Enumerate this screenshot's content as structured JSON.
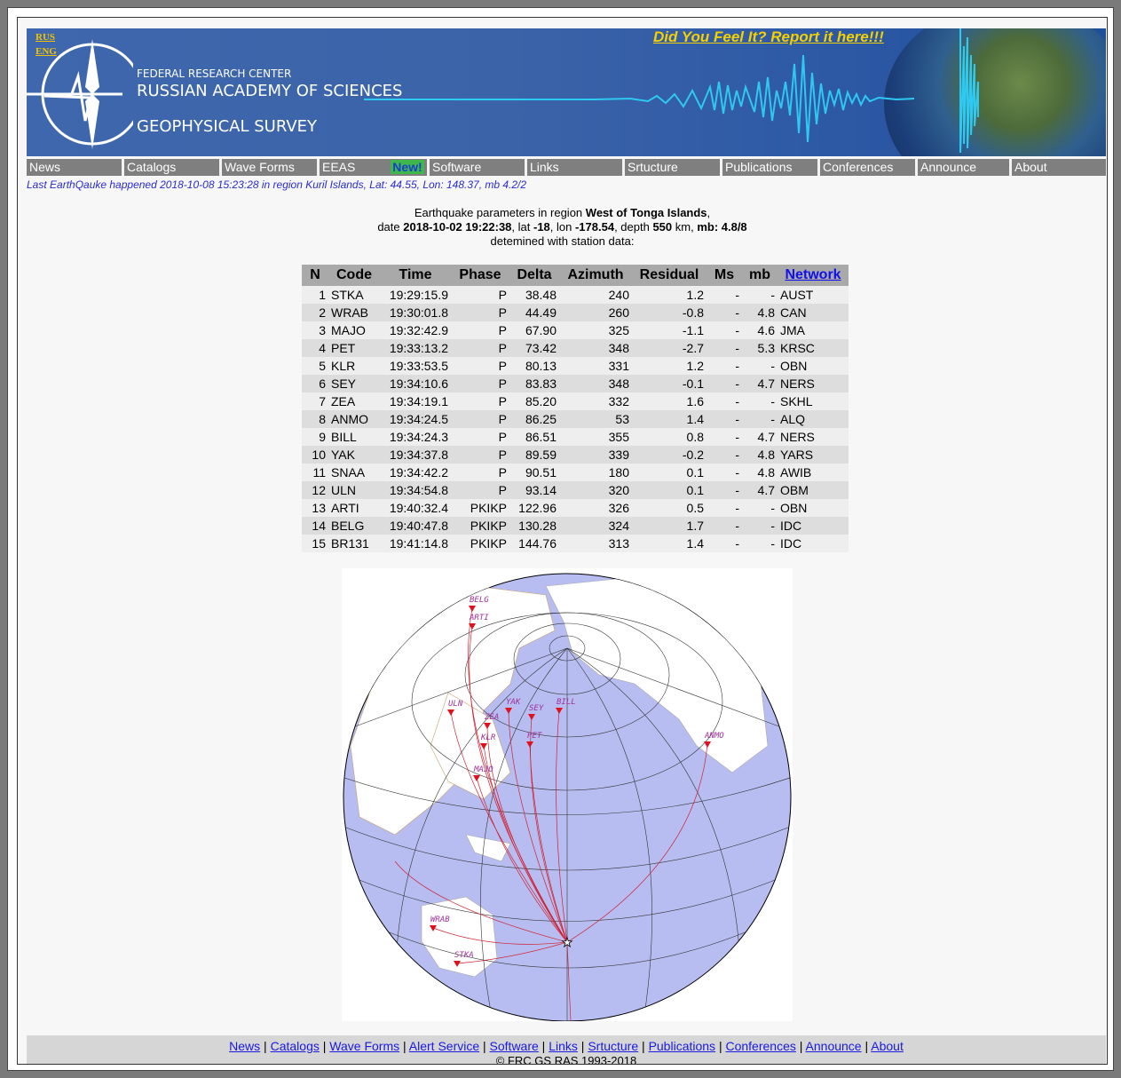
{
  "banner": {
    "lang_rus": "RUS",
    "lang_eng": "ENG",
    "line1": "FEDERAL RESEARCH CENTER",
    "line2": "RUSSIAN ACADEMY OF SCIENCES",
    "line3": "GEOPHYSICAL SURVEY",
    "feel_link": "Did You Feel It? Report it here!!!"
  },
  "nav": {
    "items": [
      "News",
      "Catalogs",
      "Wave Forms",
      "EEAS",
      "New!",
      "Software",
      "Links",
      "Srtucture",
      "Publications",
      "Conferences",
      "Announce",
      "About"
    ]
  },
  "last_quake": "Last EarthQauke happened 2018-10-08 15:23:28 in region Kuril Islands, Lat: 44.55, Lon: 148.37, mb 4.2/2",
  "params": {
    "intro": "Earthquake parameters in region ",
    "region": "West of Tonga Islands",
    "date_label": "date ",
    "date": "2018-10-02 19:22:38",
    "lat_label": ", lat ",
    "lat": "-18",
    "lon_label": ", lon ",
    "lon": "-178.54",
    "depth_label": ", depth ",
    "depth": "550",
    "km_label": " km, ",
    "mb_label": "mb: 4.8/8",
    "line3": "detemined with station data:"
  },
  "table": {
    "headers": [
      "N",
      "Code",
      "Time",
      "Phase",
      "Delta",
      "Azimuth",
      "Residual",
      "Ms",
      "mb",
      "Network"
    ],
    "rows": [
      [
        "1",
        "STKA",
        "19:29:15.9",
        "P",
        "38.48",
        "240",
        "1.2",
        "-",
        "-",
        "AUST"
      ],
      [
        "2",
        "WRAB",
        "19:30:01.8",
        "P",
        "44.49",
        "260",
        "-0.8",
        "-",
        "4.8",
        "CAN"
      ],
      [
        "3",
        "MAJO",
        "19:32:42.9",
        "P",
        "67.90",
        "325",
        "-1.1",
        "-",
        "4.6",
        "JMA"
      ],
      [
        "4",
        "PET",
        "19:33:13.2",
        "P",
        "73.42",
        "348",
        "-2.7",
        "-",
        "5.3",
        "KRSC"
      ],
      [
        "5",
        "KLR",
        "19:33:53.5",
        "P",
        "80.13",
        "331",
        "1.2",
        "-",
        "-",
        "OBN"
      ],
      [
        "6",
        "SEY",
        "19:34:10.6",
        "P",
        "83.83",
        "348",
        "-0.1",
        "-",
        "4.7",
        "NERS"
      ],
      [
        "7",
        "ZEA",
        "19:34:19.1",
        "P",
        "85.20",
        "332",
        "1.6",
        "-",
        "-",
        "SKHL"
      ],
      [
        "8",
        "ANMO",
        "19:34:24.5",
        "P",
        "86.25",
        "53",
        "1.4",
        "-",
        "-",
        "ALQ"
      ],
      [
        "9",
        "BILL",
        "19:34:24.3",
        "P",
        "86.51",
        "355",
        "0.8",
        "-",
        "4.7",
        "NERS"
      ],
      [
        "10",
        "YAK",
        "19:34:37.8",
        "P",
        "89.59",
        "339",
        "-0.2",
        "-",
        "4.8",
        "YARS"
      ],
      [
        "11",
        "SNAA",
        "19:34:42.2",
        "P",
        "90.51",
        "180",
        "0.1",
        "-",
        "4.8",
        "AWIB"
      ],
      [
        "12",
        "ULN",
        "19:34:54.8",
        "P",
        "93.14",
        "320",
        "0.1",
        "-",
        "4.7",
        "OBM"
      ],
      [
        "13",
        "ARTI",
        "19:40:32.4",
        "PKIKP",
        "122.96",
        "326",
        "0.5",
        "-",
        "-",
        "OBN"
      ],
      [
        "14",
        "BELG",
        "19:40:47.8",
        "PKIKP",
        "130.28",
        "324",
        "1.7",
        "-",
        "-",
        "IDC"
      ],
      [
        "15",
        "BR131",
        "19:41:14.8",
        "PKIKP",
        "144.76",
        "313",
        "1.4",
        "-",
        "-",
        "IDC"
      ]
    ]
  },
  "map_stations": [
    "BELG",
    "ARTI",
    "ULN",
    "YAK",
    "ZEA",
    "SEY",
    "BILL",
    "KLR",
    "PET",
    "ANMO",
    "MAJO",
    "WRAB",
    "STKA"
  ],
  "footer": {
    "links": [
      "News",
      "Catalogs",
      "Wave Forms",
      "Alert Service",
      "Software",
      "Links",
      "Srtucture",
      "Publications",
      "Conferences",
      "Announce",
      "About"
    ],
    "copyright": "© FRC GS RAS 1993-2018"
  }
}
